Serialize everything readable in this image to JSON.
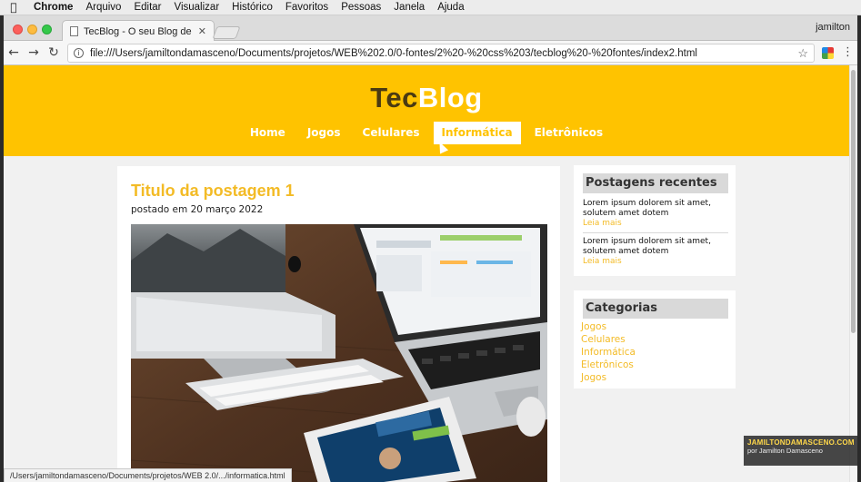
{
  "menubar": {
    "app": "Chrome",
    "items": [
      "Arquivo",
      "Editar",
      "Visualizar",
      "Histórico",
      "Favoritos",
      "Pessoas",
      "Janela",
      "Ajuda"
    ]
  },
  "browser": {
    "tab_title": "TecBlog - O seu Blog de tecno",
    "profile": "jamilton",
    "url": "file:///Users/jamiltondamasceno/Documents/projetos/WEB%202.0/0-fontes/2%20-%20css%203/tecblog%20-%20fontes/index2.html",
    "status_url": "/Users/jamiltondamasceno/Documents/projetos/WEB 2.0/.../informatica.html"
  },
  "site": {
    "logo_part1": "Tec",
    "logo_part2": "Blog",
    "nav": [
      "Home",
      "Jogos",
      "Celulares",
      "Informática",
      "Eletrônicos"
    ],
    "active_nav": "Informática"
  },
  "post": {
    "title": "Titulo da postagem 1",
    "date": "postado em 20 março 2022"
  },
  "sidebar": {
    "recent_title": "Postagens recentes",
    "recent": [
      {
        "text": "Lorem ipsum dolorem sit amet, solutem amet dotem",
        "more": "Leia mais"
      },
      {
        "text": "Lorem ipsum dolorem sit amet, solutem amet dotem",
        "more": "Leia mais"
      }
    ],
    "categories_title": "Categorias",
    "categories": [
      "Jogos",
      "Celulares",
      "Informática",
      "Eletrônicos",
      "Jogos"
    ]
  },
  "watermark": {
    "line1": "JAMILTONDAMASCENO.COM",
    "line2": "por Jamilton Damasceno"
  },
  "colors": {
    "brand_yellow": "#ffc300",
    "accent_text": "#f3bb26",
    "widget_header": "#d9d9d9"
  }
}
